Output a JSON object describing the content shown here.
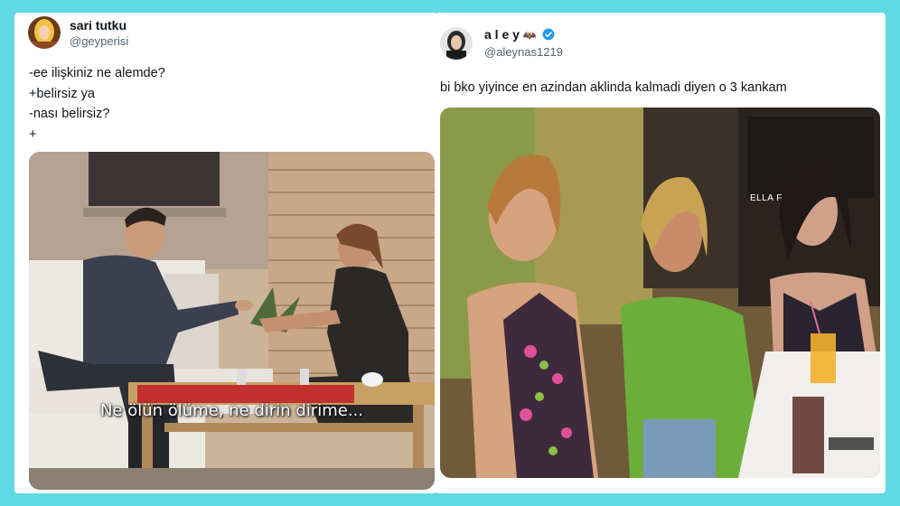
{
  "tweet_left": {
    "display_name": "sari tutku",
    "handle": "@geyperisi",
    "lines": [
      "-ee ilişkiniz ne alemde?",
      "+belirsiz ya",
      "-nası belirsiz?",
      "+"
    ],
    "subtitle": "Ne ölün ölüme, ne dirin dirime..."
  },
  "tweet_right": {
    "display_name": "a l e y",
    "handle": "@aleynas1219",
    "text": "bi bko yiyince en azindan aklinda kalmadi diyen o 3 kankam",
    "poster_text": "ELLA F"
  },
  "colors": {
    "frame": "#5fd9e3",
    "verified": "#1d9bf0",
    "text_primary": "#0f1419",
    "text_secondary": "#536471"
  }
}
